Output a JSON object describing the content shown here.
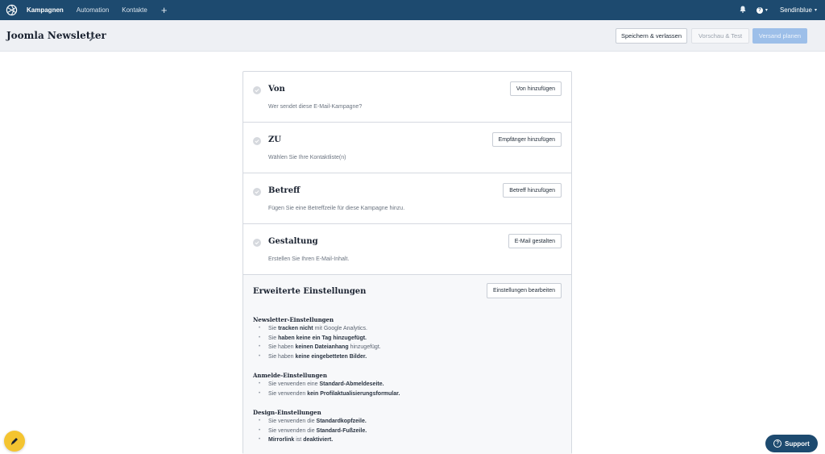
{
  "nav": {
    "items": [
      {
        "label": "Kampagnen",
        "active": true
      },
      {
        "label": "Automation"
      },
      {
        "label": "Kontakte"
      }
    ],
    "plus_icon": "plus-icon",
    "bell_icon": "bell-icon",
    "help_icon": "help-circle-icon",
    "account": "Sendinblue",
    "bg_color": "#1d4a6f"
  },
  "header": {
    "title": "Joomla Newsletter",
    "edit_icon": "pencil-icon",
    "save_label": "Speichern & verlassen",
    "preview_label": "Vorschau & Test",
    "send_label": "Versand planen"
  },
  "sections": [
    {
      "title": "Von",
      "subtitle": "Wer sendet diese E-Mail-Kampagne?",
      "button": "Von hinzufügen"
    },
    {
      "title": "ZU",
      "subtitle": "Wählen Sie Ihre Kontaktliste(n)",
      "button": "Empfänger hinzufügen"
    },
    {
      "title": "Betreff",
      "subtitle": "Fügen Sie eine Betreffzeile für diese Kampagne hinzu.",
      "button": "Betreff hinzufügen"
    },
    {
      "title": "Gestaltung",
      "subtitle": "Erstellen Sie Ihren E-Mail-Inhalt.",
      "button": "E-Mail gestalten"
    }
  ],
  "advanced": {
    "title": "Erweiterte Einstellungen",
    "button": "Einstellungen bearbeiten",
    "groups": [
      {
        "title": "Newsletter-Einstellungen",
        "items": [
          [
            {
              "t": "Sie "
            },
            {
              "t": "tracken nicht",
              "b": true
            },
            {
              "t": " mit Google Analytics."
            }
          ],
          [
            {
              "t": "Sie "
            },
            {
              "t": "haben keine ein Tag hinzugefügt.",
              "b": true
            }
          ],
          [
            {
              "t": "Sie haben "
            },
            {
              "t": "keinen Dateianhang",
              "b": true
            },
            {
              "t": " hinzugefügt."
            }
          ],
          [
            {
              "t": "Sie haben "
            },
            {
              "t": "keine eingebetteten Bilder.",
              "b": true
            }
          ]
        ]
      },
      {
        "title": "Anmelde-Einstellungen",
        "items": [
          [
            {
              "t": "Sie verwenden eine "
            },
            {
              "t": "Standard-Abmeldeseite.",
              "b": true
            }
          ],
          [
            {
              "t": "Sie verwenden "
            },
            {
              "t": "kein Profilaktualisierungsformular.",
              "b": true
            }
          ]
        ]
      },
      {
        "title": "Design-Einstellungen",
        "items": [
          [
            {
              "t": "Sie verwenden die "
            },
            {
              "t": "Standardkopfzeile.",
              "b": true
            }
          ],
          [
            {
              "t": "Sie verwenden die "
            },
            {
              "t": "Standard-Fußzeile.",
              "b": true
            }
          ],
          [
            {
              "t": "Mirrorlink",
              "b": true
            },
            {
              "t": " ist "
            },
            {
              "t": "deaktiviert.",
              "b": true
            }
          ]
        ]
      }
    ]
  },
  "floating": {
    "tool_icon": "pen-tool-icon",
    "support_label": "Support",
    "support_icon": "question-icon"
  }
}
